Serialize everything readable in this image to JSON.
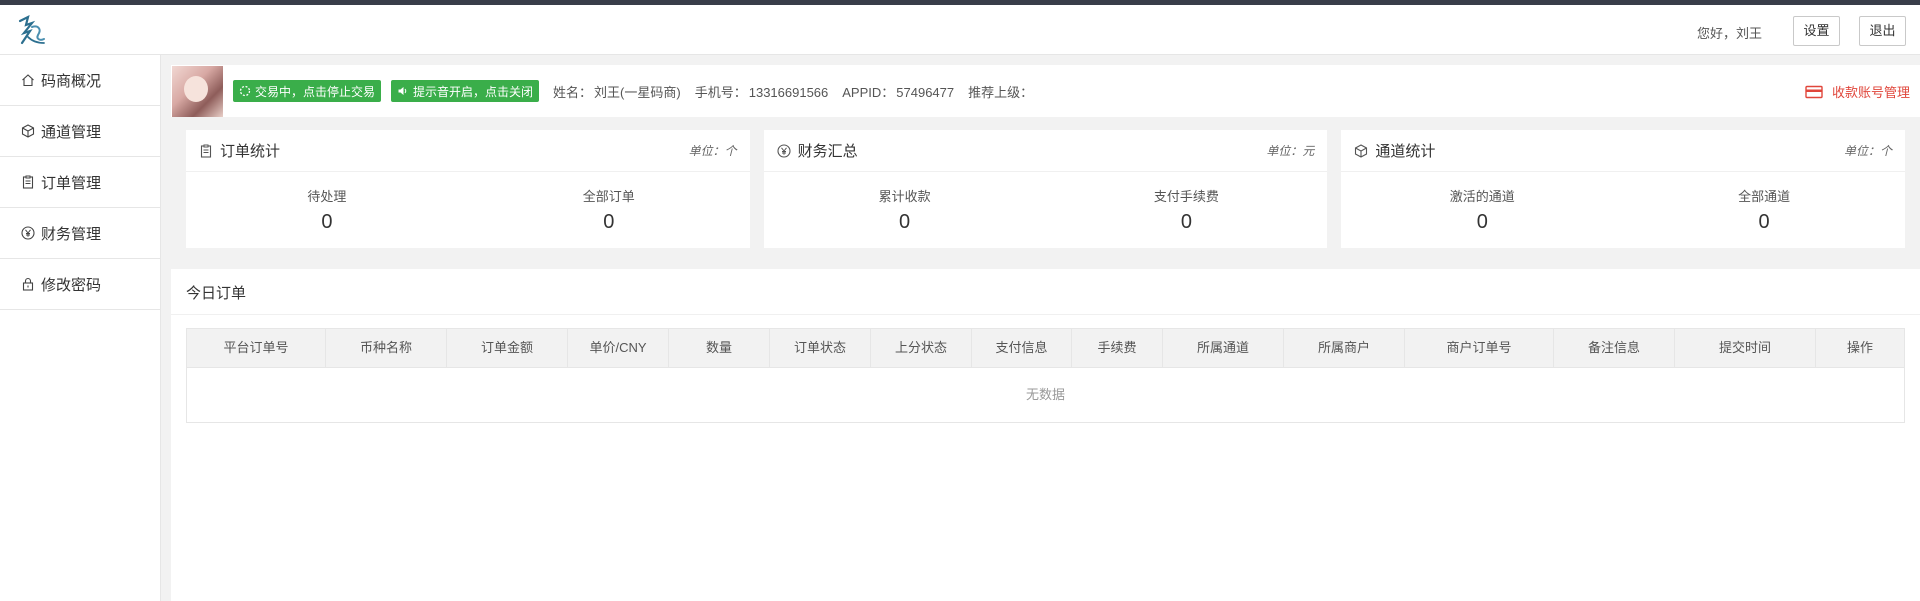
{
  "header": {
    "greeting": "您好，刘王",
    "settings_label": "设置",
    "logout_label": "退出"
  },
  "sidebar": {
    "items": [
      {
        "label": "码商概况",
        "icon": "home-icon"
      },
      {
        "label": "通道管理",
        "icon": "cube-icon"
      },
      {
        "label": "订单管理",
        "icon": "clipboard-icon"
      },
      {
        "label": "财务管理",
        "icon": "yen-icon"
      },
      {
        "label": "修改密码",
        "icon": "lock-icon"
      }
    ]
  },
  "infobar": {
    "trading_button": "交易中，点击停止交易",
    "sound_button": "提示音开启，点击关闭",
    "name_label": "姓名：",
    "name_value": "刘王(一星码商)",
    "phone_label": "手机号：",
    "phone_value": "13316691566",
    "appid_label": "APPID：",
    "appid_value": "57496477",
    "referrer_label": "推荐上级：",
    "account_link": "收款账号管理"
  },
  "cards": [
    {
      "title": "订单统计",
      "unit": "单位：个",
      "icon": "clipboard-icon",
      "stats": [
        {
          "label": "待处理",
          "value": "0"
        },
        {
          "label": "全部订单",
          "value": "0"
        }
      ]
    },
    {
      "title": "财务汇总",
      "unit": "单位：元",
      "icon": "yen-icon",
      "stats": [
        {
          "label": "累计收款",
          "value": "0"
        },
        {
          "label": "支付手续费",
          "value": "0"
        }
      ]
    },
    {
      "title": "通道统计",
      "unit": "单位：个",
      "icon": "cube-icon",
      "stats": [
        {
          "label": "激活的通道",
          "value": "0"
        },
        {
          "label": "全部通道",
          "value": "0"
        }
      ]
    }
  ],
  "orders": {
    "title": "今日订单",
    "columns": [
      "平台订单号",
      "币种名称",
      "订单金额",
      "单价/CNY",
      "数量",
      "订单状态",
      "上分状态",
      "支付信息",
      "手续费",
      "所属通道",
      "所属商户",
      "商户订单号",
      "备注信息",
      "提交时间",
      "操作"
    ],
    "empty_text": "无数据"
  },
  "colors": {
    "green": "#3aae4a",
    "red_link": "#e0463b",
    "top_strip": "#393d49"
  }
}
